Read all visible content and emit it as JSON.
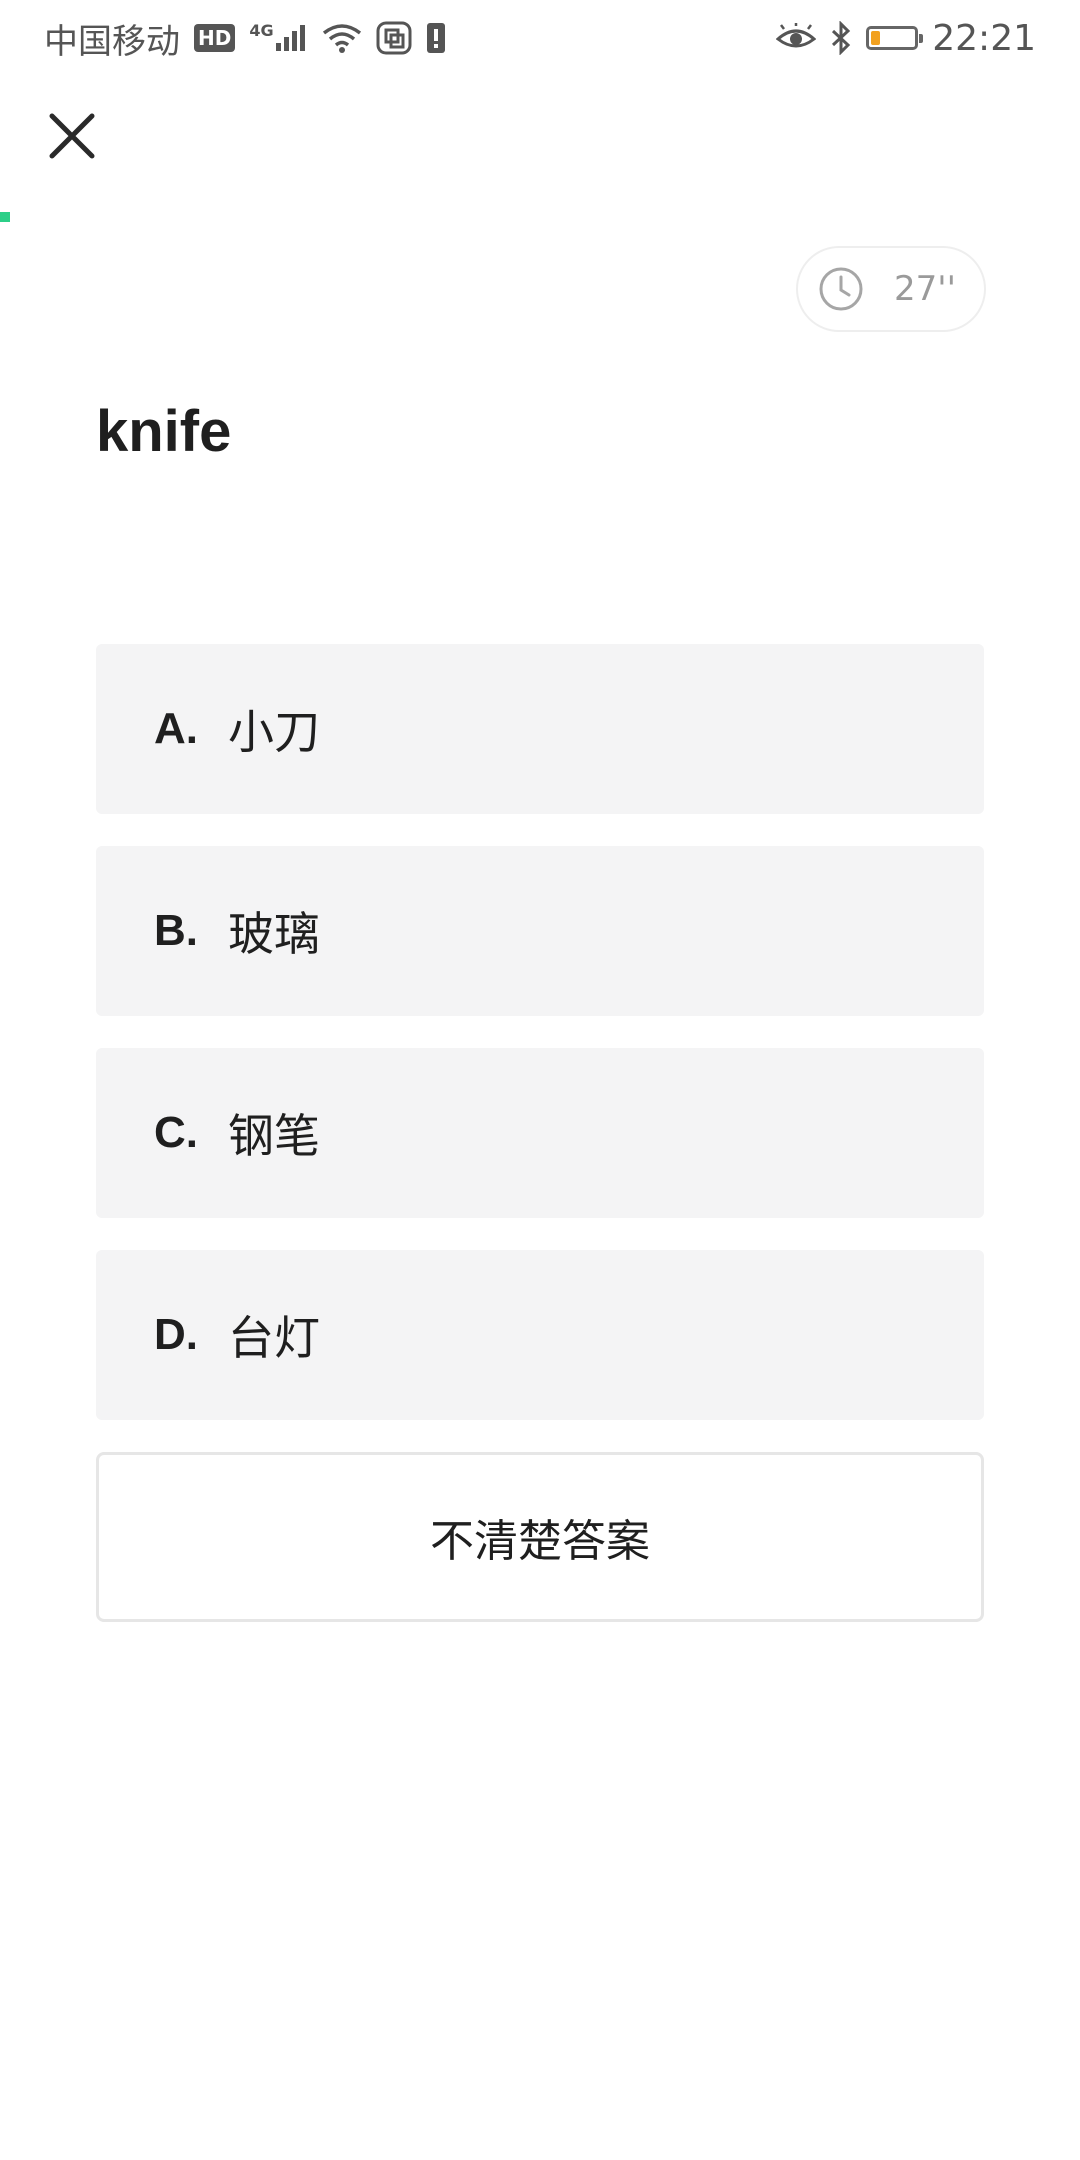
{
  "status_bar": {
    "carrier": "中国移动",
    "hd": "HD",
    "network": "4G",
    "time": "22:21",
    "battery_level": 0.2,
    "battery_color": "#f2a11f"
  },
  "quiz": {
    "timer": "27''",
    "word": "knife",
    "options": [
      {
        "letter": "A.",
        "text": "小刀"
      },
      {
        "letter": "B.",
        "text": "玻璃"
      },
      {
        "letter": "C.",
        "text": "钢笔"
      },
      {
        "letter": "D.",
        "text": "台灯"
      }
    ],
    "unsure_label": "不清楚答案"
  },
  "colors": {
    "accent": "#2ccf88",
    "option_bg": "#f4f4f5",
    "text": "#1f1f1f"
  }
}
